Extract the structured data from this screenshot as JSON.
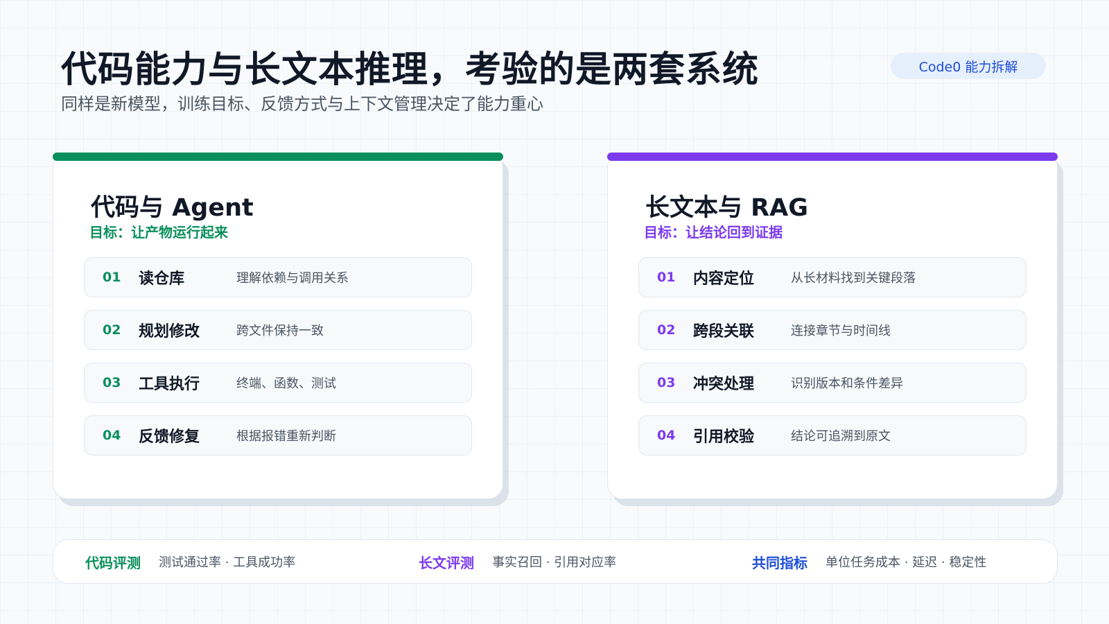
{
  "header": {
    "title": "代码能力与长文本推理，考验的是两套系统",
    "subtitle": "同样是新模型，训练目标、反馈方式与上下文管理决定了能力重心",
    "badge": "Code0 能力拆解"
  },
  "cards": [
    {
      "title": "代码与 Agent",
      "goal": "目标：让产物运行起来",
      "accent": "#0a8f5c",
      "steps": [
        {
          "num": "01",
          "name": "读仓库",
          "desc": "理解依赖与调用关系"
        },
        {
          "num": "02",
          "name": "规划修改",
          "desc": "跨文件保持一致"
        },
        {
          "num": "03",
          "name": "工具执行",
          "desc": "终端、函数、测试"
        },
        {
          "num": "04",
          "name": "反馈修复",
          "desc": "根据报错重新判断"
        }
      ]
    },
    {
      "title": "长文本与 RAG",
      "goal": "目标：让结论回到证据",
      "accent": "#7c3aed",
      "steps": [
        {
          "num": "01",
          "name": "内容定位",
          "desc": "从长材料找到关键段落"
        },
        {
          "num": "02",
          "name": "跨段关联",
          "desc": "连接章节与时间线"
        },
        {
          "num": "03",
          "name": "冲突处理",
          "desc": "识别版本和条件差异"
        },
        {
          "num": "04",
          "name": "引用校验",
          "desc": "结论可追溯到原文"
        }
      ]
    }
  ],
  "footer": {
    "metrics": [
      {
        "label": "代码评测",
        "value": "测试通过率 · 工具成功率",
        "color": "#0a8f5c"
      },
      {
        "label": "长文评测",
        "value": "事实召回 · 引用对应率",
        "color": "#7c3aed"
      },
      {
        "label": "共同指标",
        "value": "单位任务成本 · 延迟 · 稳定性",
        "color": "#1d4ed8"
      }
    ]
  }
}
